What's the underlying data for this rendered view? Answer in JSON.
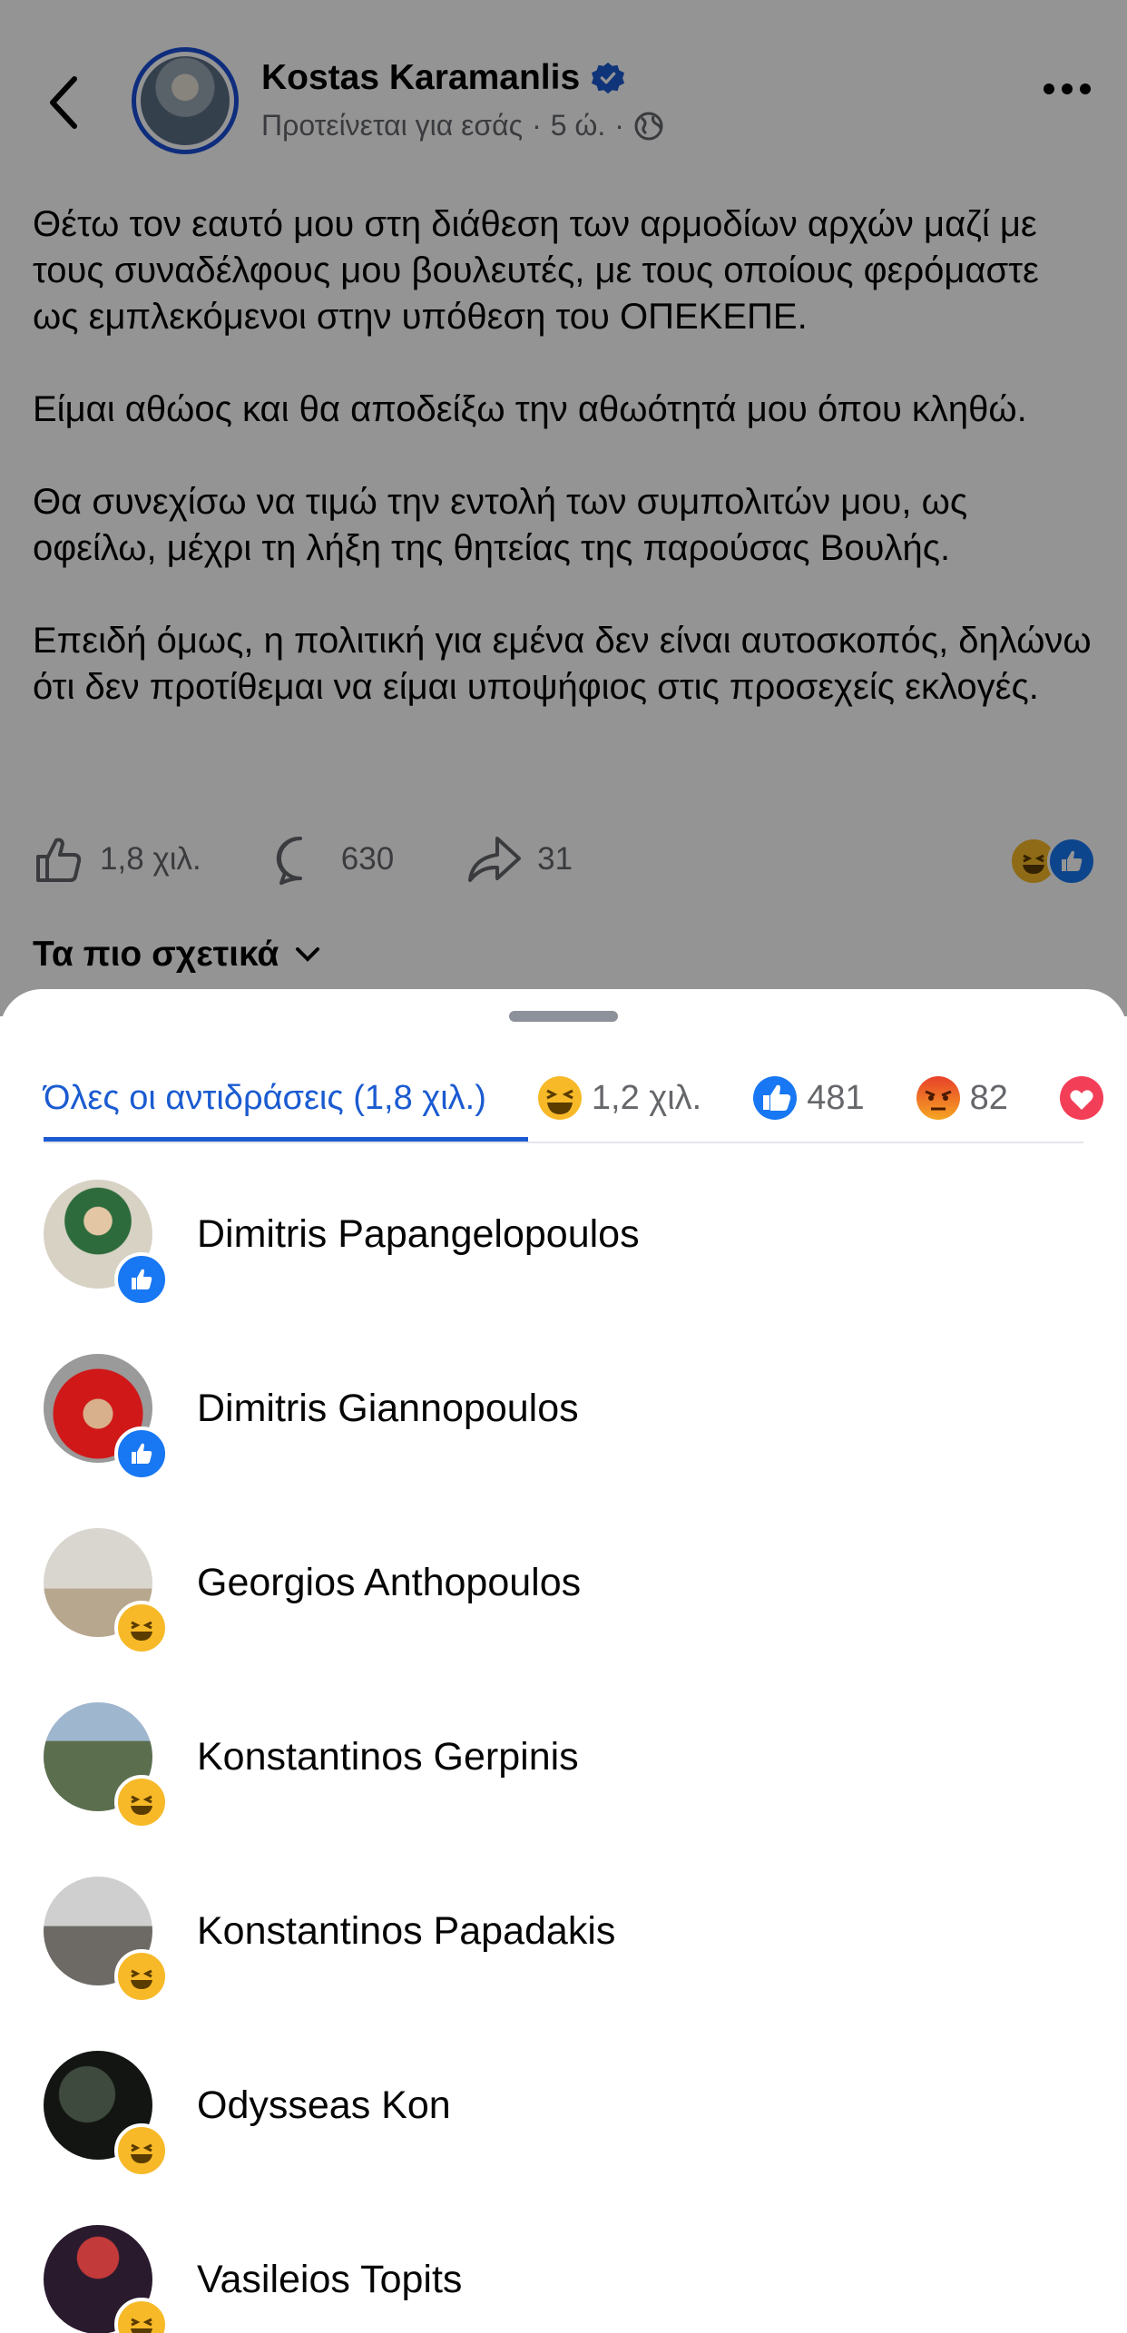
{
  "post": {
    "author": "Kostas Karamanlis",
    "suggested": "Προτείνεται για εσάς",
    "time": "5 ώ.",
    "separator": "·",
    "paragraphs": [
      "Θέτω τον εαυτό μου στη διάθεση των αρμοδίων αρχών μαζί με τους συναδέλφους μου βουλευτές, με τους οποίους φερόμαστε ως εμπλεκόμενοι στην υπόθεση του ΟΠΕΚΕΠΕ.",
      "Είμαι αθώος και θα αποδείξω την αθωότητά μου όπου κληθώ.",
      "Θα συνεχίσω να τιμώ την εντολή των συμπολιτών μου, ως οφείλω, μέχρι τη λήξη της θητείας της παρούσας Βουλής.",
      "Επειδή όμως, η πολιτική για εμένα δεν είναι αυτοσκοπός, δηλώνω ότι δεν προτίθεμαι να είμαι υποψήφιος στις προσεχείς εκλογές."
    ],
    "likes": "1,8 χιλ.",
    "comments": "630",
    "shares": "31",
    "sort_label": "Τα πιο σχετικά"
  },
  "sheet": {
    "tabs": [
      {
        "label": "Όλες οι αντιδράσεις (1,8 χιλ.)",
        "icon": null
      },
      {
        "label": "1,2 χιλ.",
        "icon": "haha"
      },
      {
        "label": "481",
        "icon": "like"
      },
      {
        "label": "82",
        "icon": "angry"
      }
    ],
    "people": [
      {
        "name": "Dimitris Papangelopoulos",
        "reaction": "like"
      },
      {
        "name": "Dimitris Giannopoulos",
        "reaction": "like"
      },
      {
        "name": "Georgios Anthopoulos",
        "reaction": "haha"
      },
      {
        "name": "Konstantinos Gerpinis",
        "reaction": "haha"
      },
      {
        "name": "Konstantinos Papadakis",
        "reaction": "haha"
      },
      {
        "name": "Odysseas Kon",
        "reaction": "haha"
      },
      {
        "name": "Vasileios Topits",
        "reaction": "haha"
      }
    ]
  },
  "colors": {
    "accent": "#1b5bd1",
    "like": "#1877f2",
    "haha": "#f7b928",
    "angry": "#e9710f",
    "love": "#f33e58"
  }
}
